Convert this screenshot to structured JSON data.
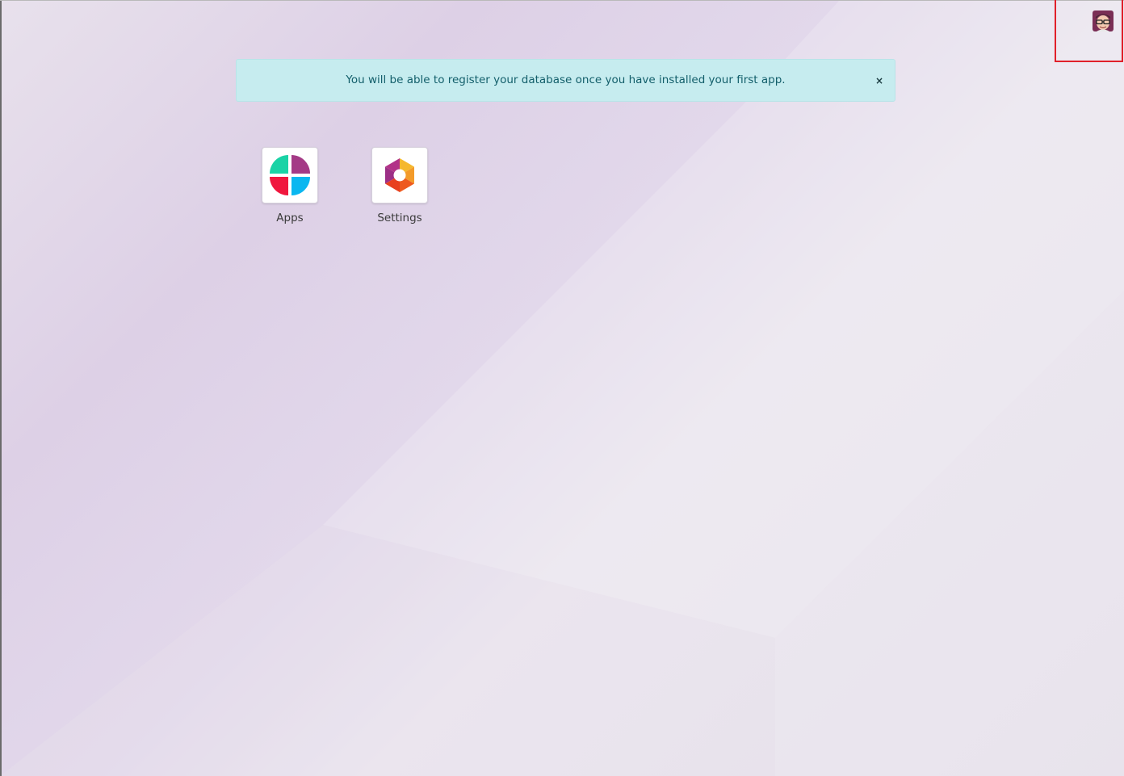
{
  "alert": {
    "message": "You will be able to register your database once you have installed your first app.",
    "close_symbol": "×"
  },
  "apps": [
    {
      "label": "Apps",
      "icon": "apps-icon"
    },
    {
      "label": "Settings",
      "icon": "settings-icon"
    }
  ],
  "user_menu": {
    "icon": "user-avatar-icon"
  },
  "colors": {
    "alert_bg": "#c6ecef",
    "alert_text": "#125e6a",
    "highlight": "#e0202a"
  }
}
